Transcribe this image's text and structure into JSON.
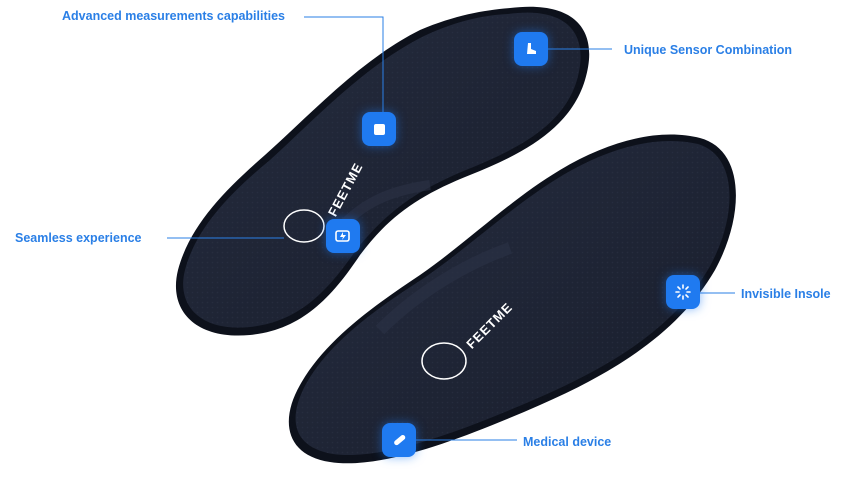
{
  "callouts": {
    "advanced": "Advanced measurements capabilities",
    "unique": "Unique Sensor Combination",
    "seamless": "Seamless experience",
    "invisible": "Invisible Insole",
    "medical": "Medical device"
  },
  "brand": {
    "top": "FEETME",
    "bottom": "FEETME"
  },
  "icons": {
    "advanced": "square-sensor-icon",
    "unique": "foot-icon",
    "seamless": "battery-charging-icon",
    "invisible": "loading-spinner-icon",
    "medical": "pill-capsule-icon"
  },
  "colors": {
    "accent": "#2a7fe6",
    "badge": "#1f7af0",
    "insole": "#1c2233",
    "insole_edge": "#0d111b"
  }
}
